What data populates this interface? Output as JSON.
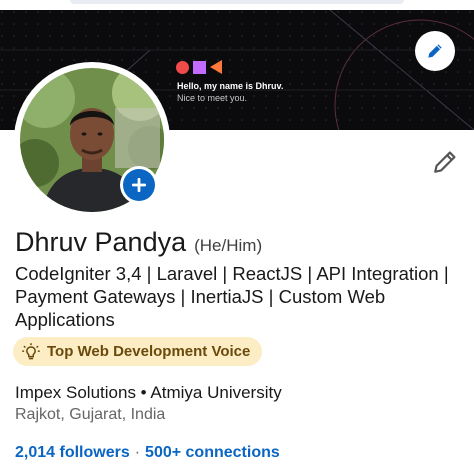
{
  "banner": {
    "hello": "Hello, my name is Dhruv.",
    "nice": "Nice to meet you.",
    "brand_icon": "shapes-logo-icon",
    "edit_icon": "pencil-icon"
  },
  "profile": {
    "name": "Dhruv Pandya",
    "pronouns": "(He/Him)",
    "headline": "CodeIgniter 3,4 | Laravel | ReactJS | API Integration | Payment Gateways | InertiaJS | Custom Web Applications",
    "badge": "Top Web Development Voice",
    "badge_icon": "lightbulb-icon",
    "company": "Impex Solutions • Atmiya University",
    "location": "Rajkot, Gujarat, India",
    "followers": "2,014 followers",
    "separator": "·",
    "connections": "500+ connections",
    "add_photo_icon": "plus-icon",
    "edit_icon": "pencil-icon"
  },
  "colors": {
    "accent": "#0a66c2",
    "banner_bg": "#0b0b0d",
    "badge_bg": "#fdedc5",
    "badge_text": "#6a4a0c",
    "muted": "#666666"
  }
}
